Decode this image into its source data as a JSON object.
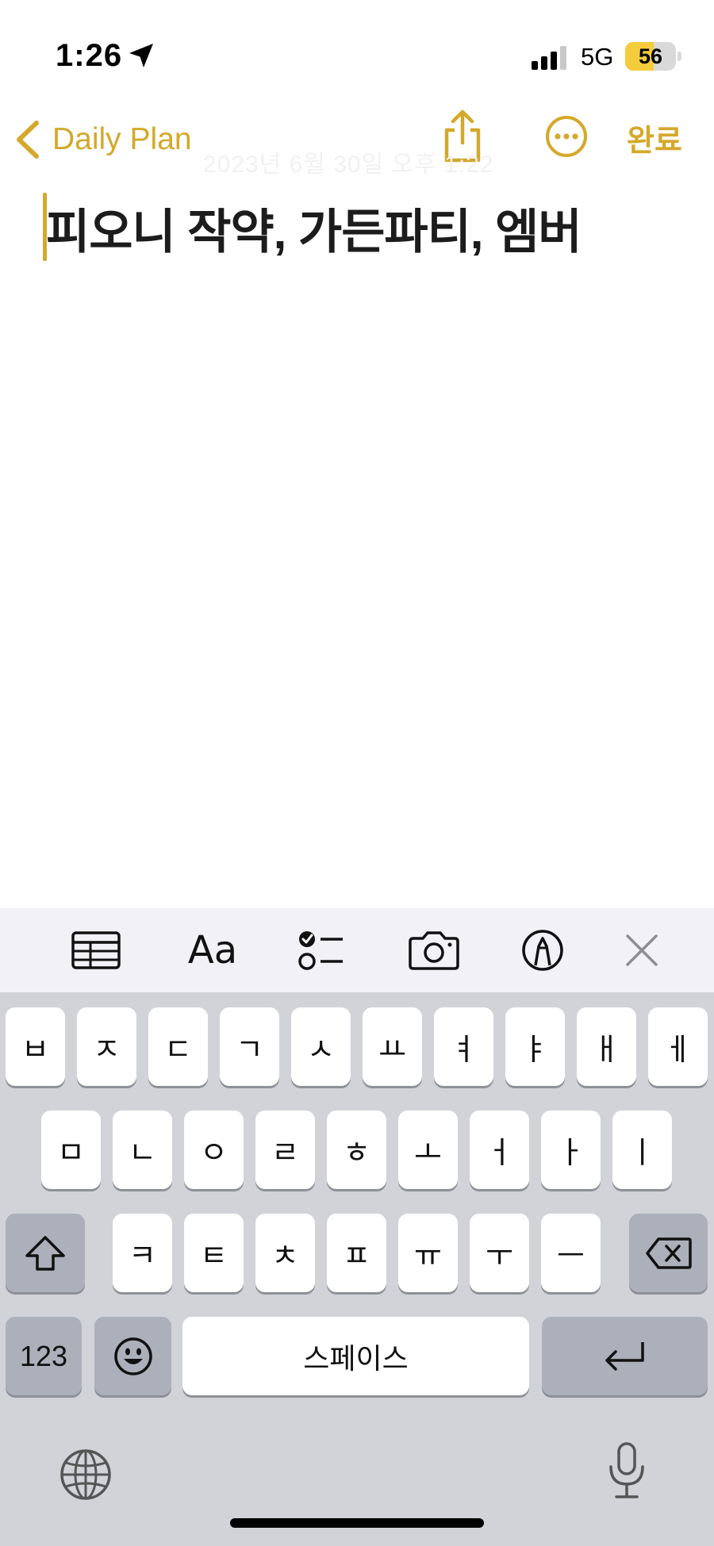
{
  "status_bar": {
    "time": "1:26",
    "network": "5G",
    "battery_percent": 56,
    "battery_label": "56",
    "icons": [
      "location-arrow-icon",
      "cellular-signal-icon",
      "battery-icon"
    ]
  },
  "nav": {
    "back_label": "Daily Plan",
    "done_label": "완료",
    "faded_date": "2023년 6월 30일 오후 1:22",
    "icons": [
      "chevron-left-icon",
      "share-icon",
      "more-icon"
    ]
  },
  "note": {
    "title": "피오니 작약, 가든파티, 엠버"
  },
  "toolbar": {
    "format_label": "Aa",
    "icons": [
      "table-icon",
      "format-icon",
      "checklist-icon",
      "camera-icon",
      "markup-icon",
      "close-icon"
    ]
  },
  "keyboard": {
    "row1": [
      "ㅂ",
      "ㅈ",
      "ㄷ",
      "ㄱ",
      "ㅅ",
      "ㅛ",
      "ㅕ",
      "ㅑ",
      "ㅐ",
      "ㅔ"
    ],
    "row2": [
      "ㅁ",
      "ㄴ",
      "ㅇ",
      "ㄹ",
      "ㅎ",
      "ㅗ",
      "ㅓ",
      "ㅏ",
      "ㅣ"
    ],
    "row3": [
      "ㅋ",
      "ㅌ",
      "ㅊ",
      "ㅍ",
      "ㅠ",
      "ㅜ",
      "ㅡ"
    ],
    "numbers_label": "123",
    "space_label": "스페이스",
    "icons": [
      "shift-icon",
      "delete-icon",
      "emoji-icon",
      "return-icon",
      "globe-icon",
      "microphone-icon"
    ]
  },
  "colors": {
    "accent": "#d4a82a",
    "keyboard_bg": "#d1d3d9",
    "key_bg": "#ffffff",
    "key_dark_bg": "#abb0ba",
    "toolbar_bg": "#f2f2f6",
    "battery_fill": "#f5cc3b"
  }
}
